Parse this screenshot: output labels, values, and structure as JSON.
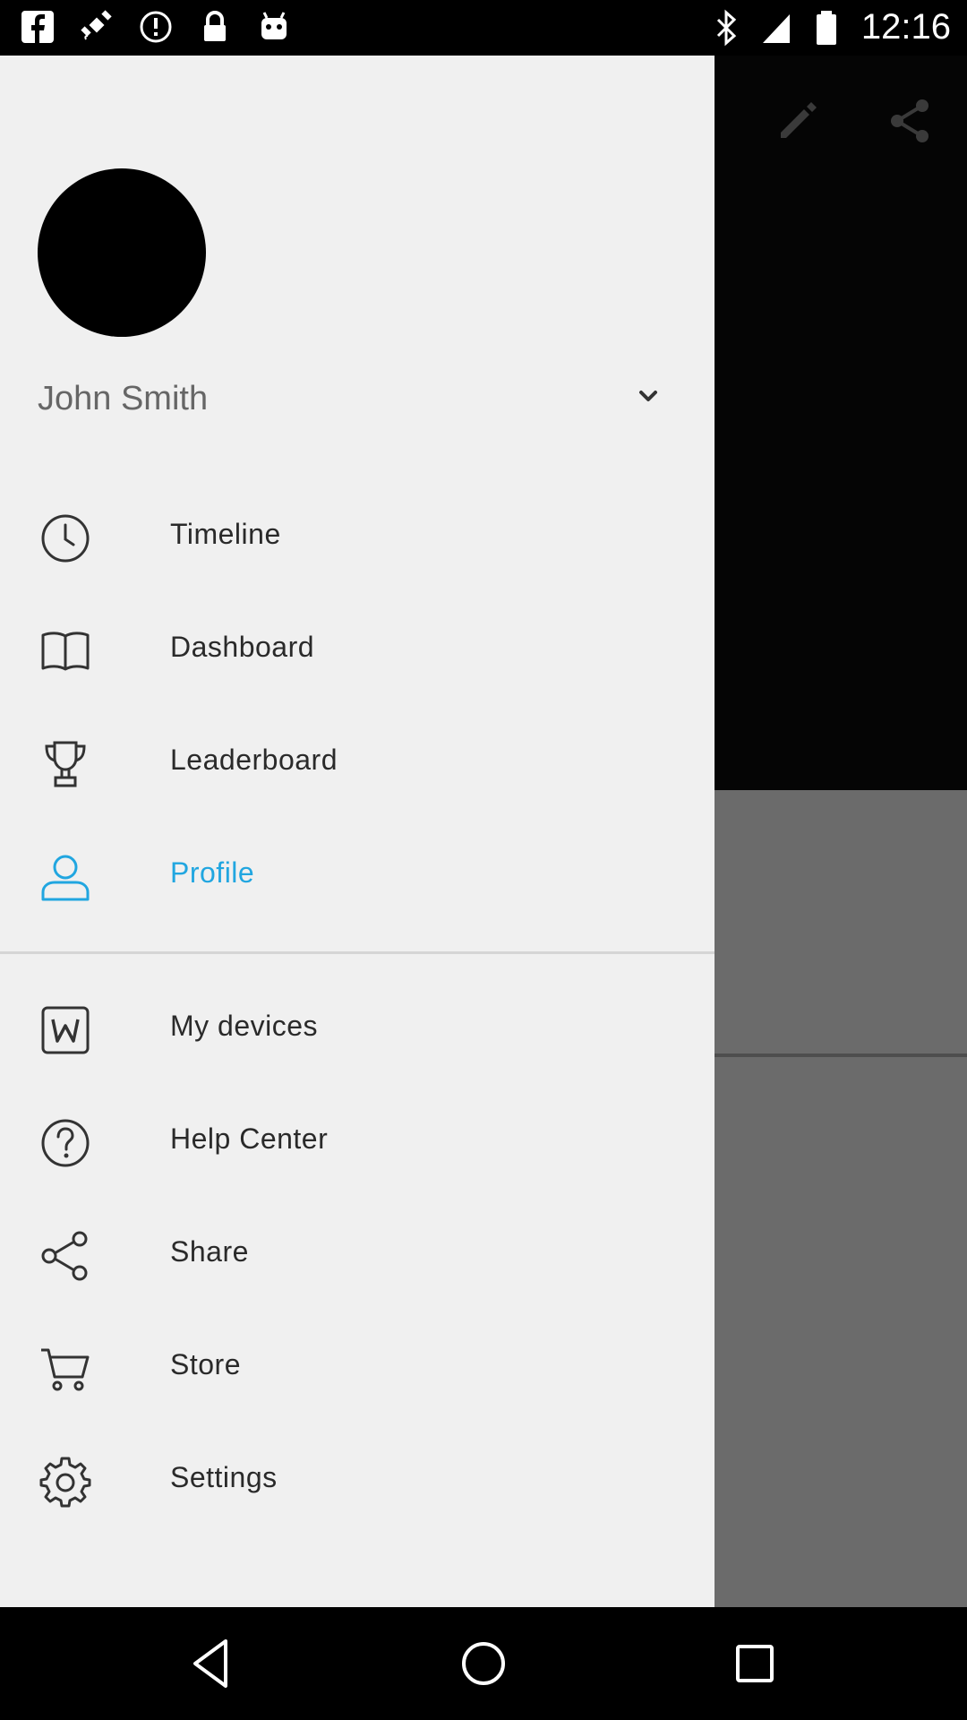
{
  "status_bar": {
    "time": "12:16",
    "left_icons": [
      "facebook-icon",
      "satellite-icon",
      "fake-gps-icon",
      "lock-icon",
      "android-icon"
    ],
    "right_icons": [
      "bluetooth-icon",
      "signal-icon",
      "battery-icon"
    ]
  },
  "app_bar": {
    "icons": [
      "edit-icon",
      "share-icon"
    ]
  },
  "drawer": {
    "user": {
      "name": "John Smith"
    },
    "items": [
      {
        "label": "Timeline",
        "icon": "clock-icon",
        "active": false
      },
      {
        "label": "Dashboard",
        "icon": "book-icon",
        "active": false
      },
      {
        "label": "Leaderboard",
        "icon": "trophy-icon",
        "active": false
      },
      {
        "label": "Profile",
        "icon": "person-icon",
        "active": true
      },
      {
        "label": "My devices",
        "icon": "device-w-icon",
        "active": false
      },
      {
        "label": "Help Center",
        "icon": "help-icon",
        "active": false
      },
      {
        "label": "Share",
        "icon": "share-icon",
        "active": false
      },
      {
        "label": "Store",
        "icon": "cart-icon",
        "active": false
      },
      {
        "label": "Settings",
        "icon": "gear-icon",
        "active": false
      }
    ],
    "active_color": "#21a6e0"
  },
  "nav_bar": {
    "buttons": [
      "back-icon",
      "home-icon",
      "recents-icon"
    ]
  }
}
